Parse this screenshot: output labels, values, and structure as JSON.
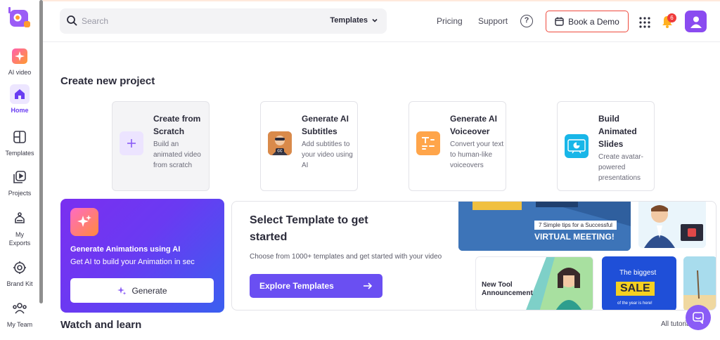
{
  "sidebar": {
    "items": [
      {
        "label": "AI video",
        "icon": "ai-sparkle-icon"
      },
      {
        "label": "Home",
        "icon": "home-icon",
        "active": true
      },
      {
        "label": "Templates",
        "icon": "templates-grid-icon"
      },
      {
        "label": "Projects",
        "icon": "projects-icon"
      },
      {
        "label": "My Exports",
        "icon": "exports-icon"
      },
      {
        "label": "Brand Kit",
        "icon": "brand-kit-icon"
      },
      {
        "label": "My Team",
        "icon": "team-icon"
      }
    ]
  },
  "header": {
    "search_placeholder": "Search",
    "search_scope": "Templates",
    "links": [
      "Pricing",
      "Support"
    ],
    "demo_label": "Book a Demo",
    "notification_count": "6"
  },
  "create": {
    "title": "Create new project",
    "cards": [
      {
        "title": "Create from Scratch",
        "desc": "Build an animated video from scratch"
      },
      {
        "title": "Generate AI Subtitles",
        "desc": "Add subtitles to your video using AI"
      },
      {
        "title": "Generate AI Voiceover",
        "desc": "Convert your text to human-like voiceovers"
      },
      {
        "title": "Build Animated Slides",
        "desc": "Create avatar-powered presentations"
      }
    ]
  },
  "generate": {
    "title": "Generate Animations using AI",
    "subtitle": "Get AI to build your Animation in sec",
    "button": "Generate"
  },
  "template_panel": {
    "title": "Select Template to get started",
    "desc": "Choose from 1000+ templates and get started with your video",
    "button": "Explore Templates",
    "thumbs": {
      "meeting_small": "7 Simple tips for a Successful",
      "meeting_big": "VIRTUAL MEETING!",
      "announce": "New Tool Announcement",
      "sale_top": "The biggest",
      "sale_big": "SALE",
      "sale_bottom": "of the year is here!"
    }
  },
  "watch": {
    "title": "Watch and learn",
    "link": "All tutorials"
  },
  "colors": {
    "accent": "#6a4ff2",
    "demo_border": "#ef4a3d"
  }
}
